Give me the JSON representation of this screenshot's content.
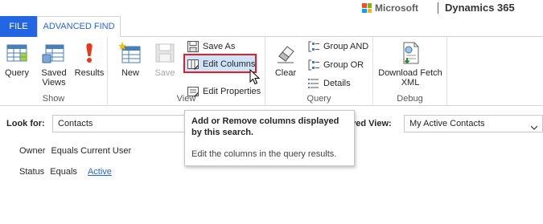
{
  "brand": {
    "microsoft": "Microsoft",
    "product": "Dynamics 365",
    "logo_colors": [
      "#f25022",
      "#7fba00",
      "#00a4ef",
      "#ffb900"
    ]
  },
  "tabs": {
    "file": "FILE",
    "advanced_find": "ADVANCED FIND"
  },
  "ribbon": {
    "show": {
      "label": "Show",
      "query": "Query",
      "saved_views": "Saved Views",
      "results": "Results"
    },
    "view": {
      "label": "View",
      "new": "New",
      "save": "Save",
      "save_as": "Save As",
      "edit_columns": "Edit Columns",
      "edit_properties": "Edit Properties"
    },
    "query": {
      "label": "Query",
      "clear": "Clear",
      "group_and": "Group AND",
      "group_or": "Group OR",
      "details": "Details"
    },
    "debug": {
      "label": "Debug",
      "download_fetch_xml": "Download Fetch XML"
    }
  },
  "look_for": {
    "label": "Look for:",
    "value": "Contacts"
  },
  "saved_view": {
    "label": "aved View:",
    "value": "My Active Contacts"
  },
  "criteria": [
    {
      "field": "Owner",
      "operator": "Equals Current User",
      "value": ""
    },
    {
      "field": "Status",
      "operator": "Equals",
      "value": "Active"
    }
  ],
  "tooltip": {
    "title": "Add or Remove columns displayed by this search.",
    "description": "Edit the columns in the query results."
  },
  "colors": {
    "accent": "#2266e3",
    "highlight_border": "#e01f26"
  }
}
